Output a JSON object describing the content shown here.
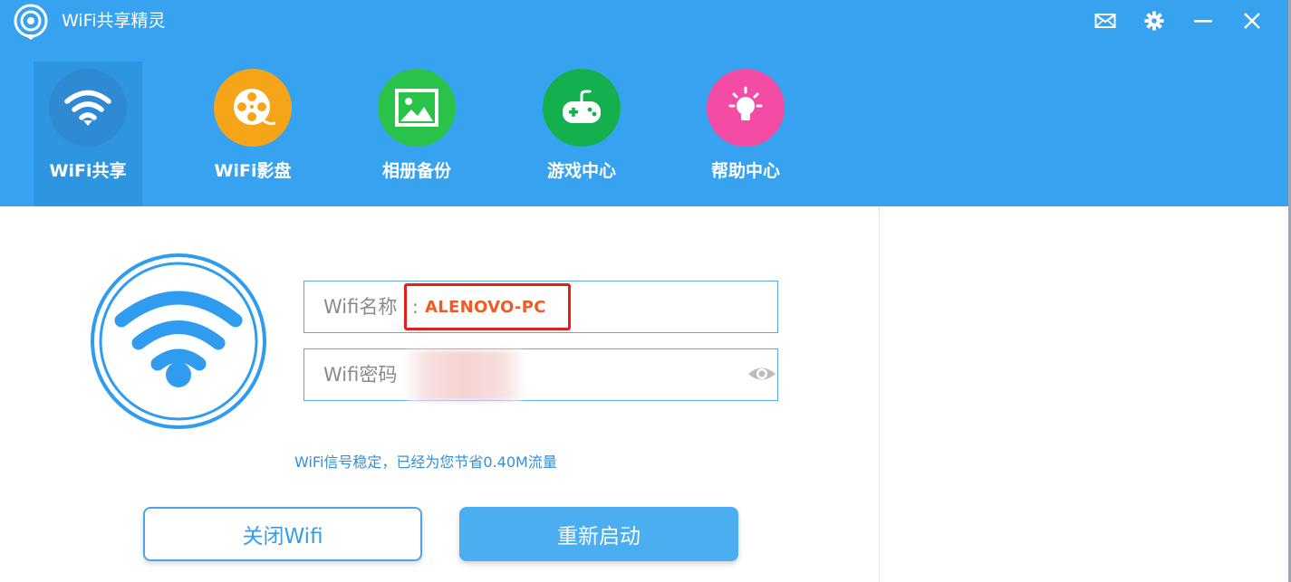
{
  "app": {
    "title": "WiFi共享精灵"
  },
  "window_controls": [
    "mail-icon",
    "gear-icon",
    "minimize-icon",
    "close-icon"
  ],
  "nav": {
    "items": [
      {
        "label": "WiFi共享",
        "icon": "wifi-icon",
        "color": "#2f8ad4",
        "active": true
      },
      {
        "label": "WiFi影盘",
        "icon": "film-reel-icon",
        "color": "#f6a518",
        "active": false
      },
      {
        "label": "相册备份",
        "icon": "image-icon",
        "color": "#2bc24a",
        "active": false
      },
      {
        "label": "游戏中心",
        "icon": "gamepad-icon",
        "color": "#14b04e",
        "active": false
      },
      {
        "label": "帮助中心",
        "icon": "lightbulb-icon",
        "color": "#f44ca5",
        "active": false
      }
    ]
  },
  "form": {
    "ssid_label": "Wifi名称",
    "ssid_colon": ":",
    "ssid_value": "ALENOVO-PC",
    "password_label": "Wifi密码"
  },
  "status": {
    "text": "WiFi信号稳定，已经为您节省0.40M流量"
  },
  "buttons": {
    "close_wifi": "关闭Wifi",
    "restart": "重新启动"
  },
  "colors": {
    "header": "#37a3f0",
    "accent": "#2f8fdb",
    "highlight_border": "#e51d1d",
    "ssid_text": "#f15a24"
  }
}
